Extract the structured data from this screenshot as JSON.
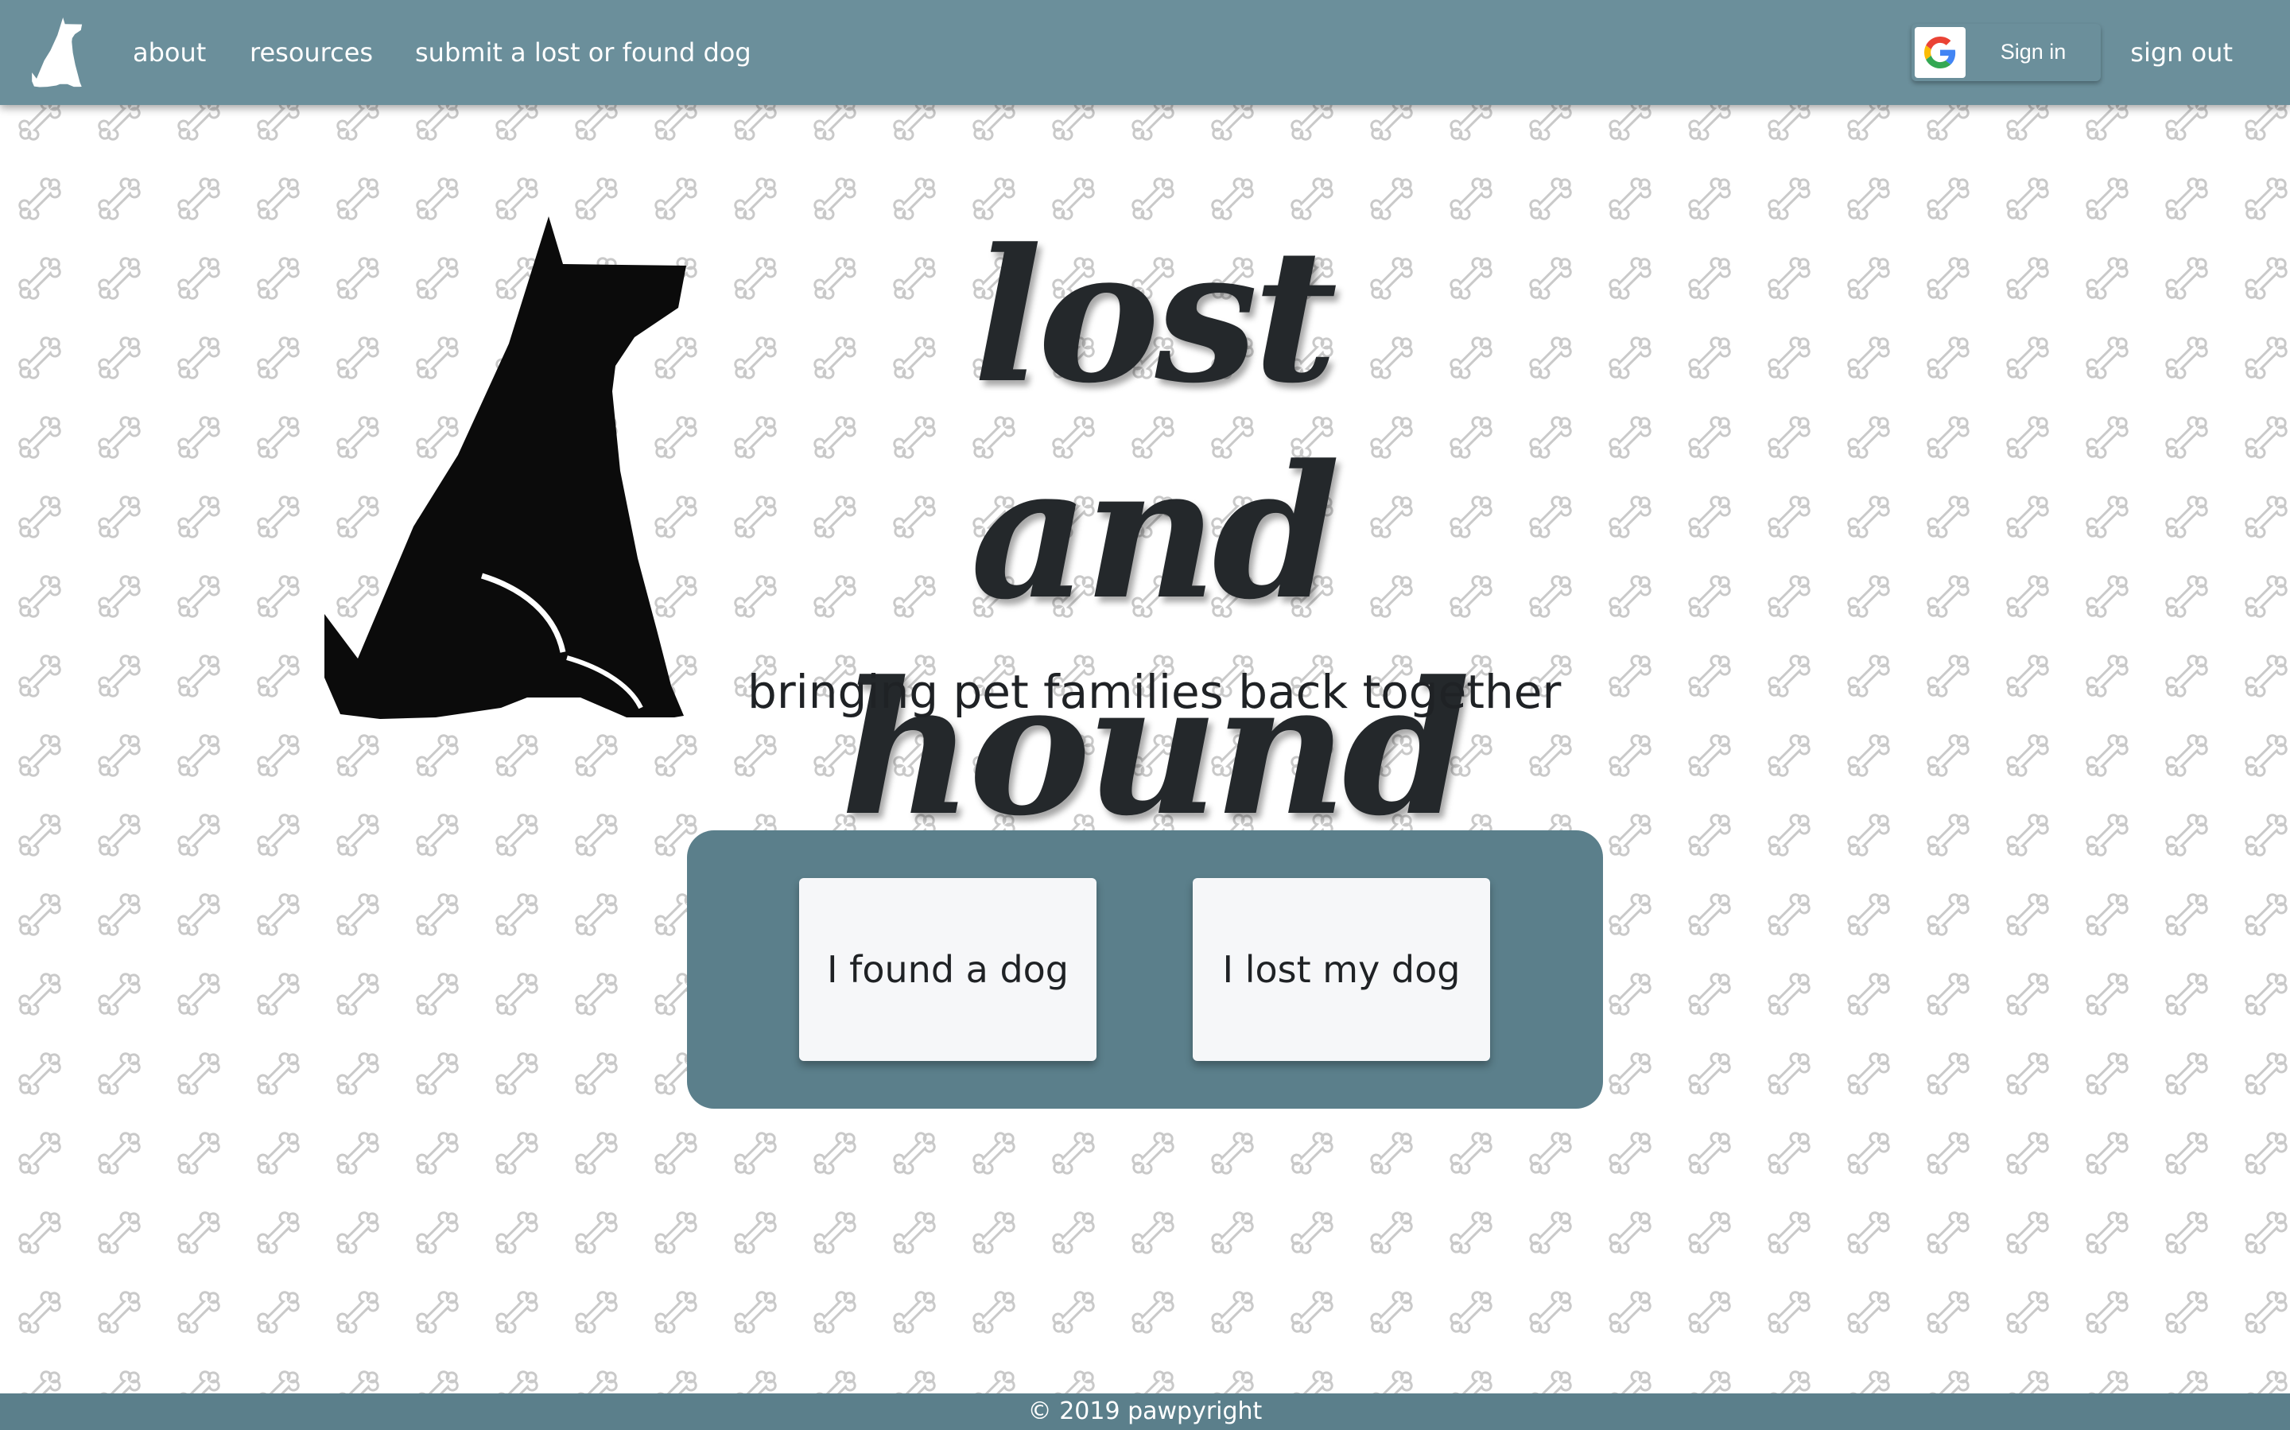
{
  "nav": {
    "logo_icon": "dog-silhouette-icon",
    "links": {
      "about": "about",
      "resources": "resources",
      "submit": "submit a lost or found dog",
      "sign_out": "sign out"
    },
    "google_signin": {
      "icon": "google-g-icon",
      "label": "Sign in"
    }
  },
  "hero": {
    "dog_icon": "dog-silhouette-icon",
    "title_line1": "lost and",
    "title_line2": "hound",
    "tagline": "bringing pet families back together"
  },
  "actions": {
    "found_label": "I found a dog",
    "lost_label": "I lost my dog"
  },
  "footer": {
    "text": "© 2019 pawpyright"
  },
  "colors": {
    "navbar": "#6b8f9b",
    "panel": "#5b7f8b",
    "button_bg": "#f6f7f9",
    "text_dark": "#24282b",
    "bone_outline": "#c8c8c8"
  }
}
